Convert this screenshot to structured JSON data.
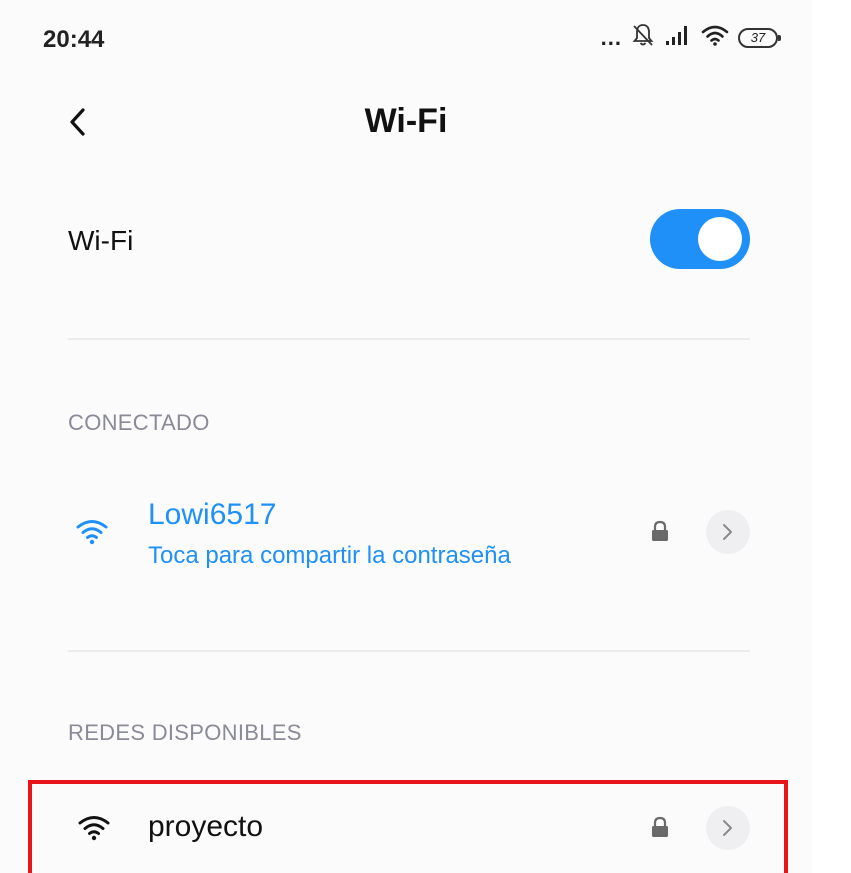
{
  "status_bar": {
    "time": "20:44",
    "dots": "...",
    "battery_level": "37"
  },
  "header": {
    "title": "Wi-Fi"
  },
  "wifi_toggle": {
    "label": "Wi-Fi",
    "enabled": true
  },
  "connected_section": {
    "header": "CONECTADO",
    "network": {
      "name": "Lowi6517",
      "subtitle": "Toca para compartir la contraseña",
      "secured": true
    }
  },
  "available_section": {
    "header": "REDES DISPONIBLES",
    "networks": [
      {
        "name": "proyecto",
        "secured": true
      }
    ]
  },
  "colors": {
    "accent": "#1e90f8",
    "highlight": "#e8141c"
  }
}
